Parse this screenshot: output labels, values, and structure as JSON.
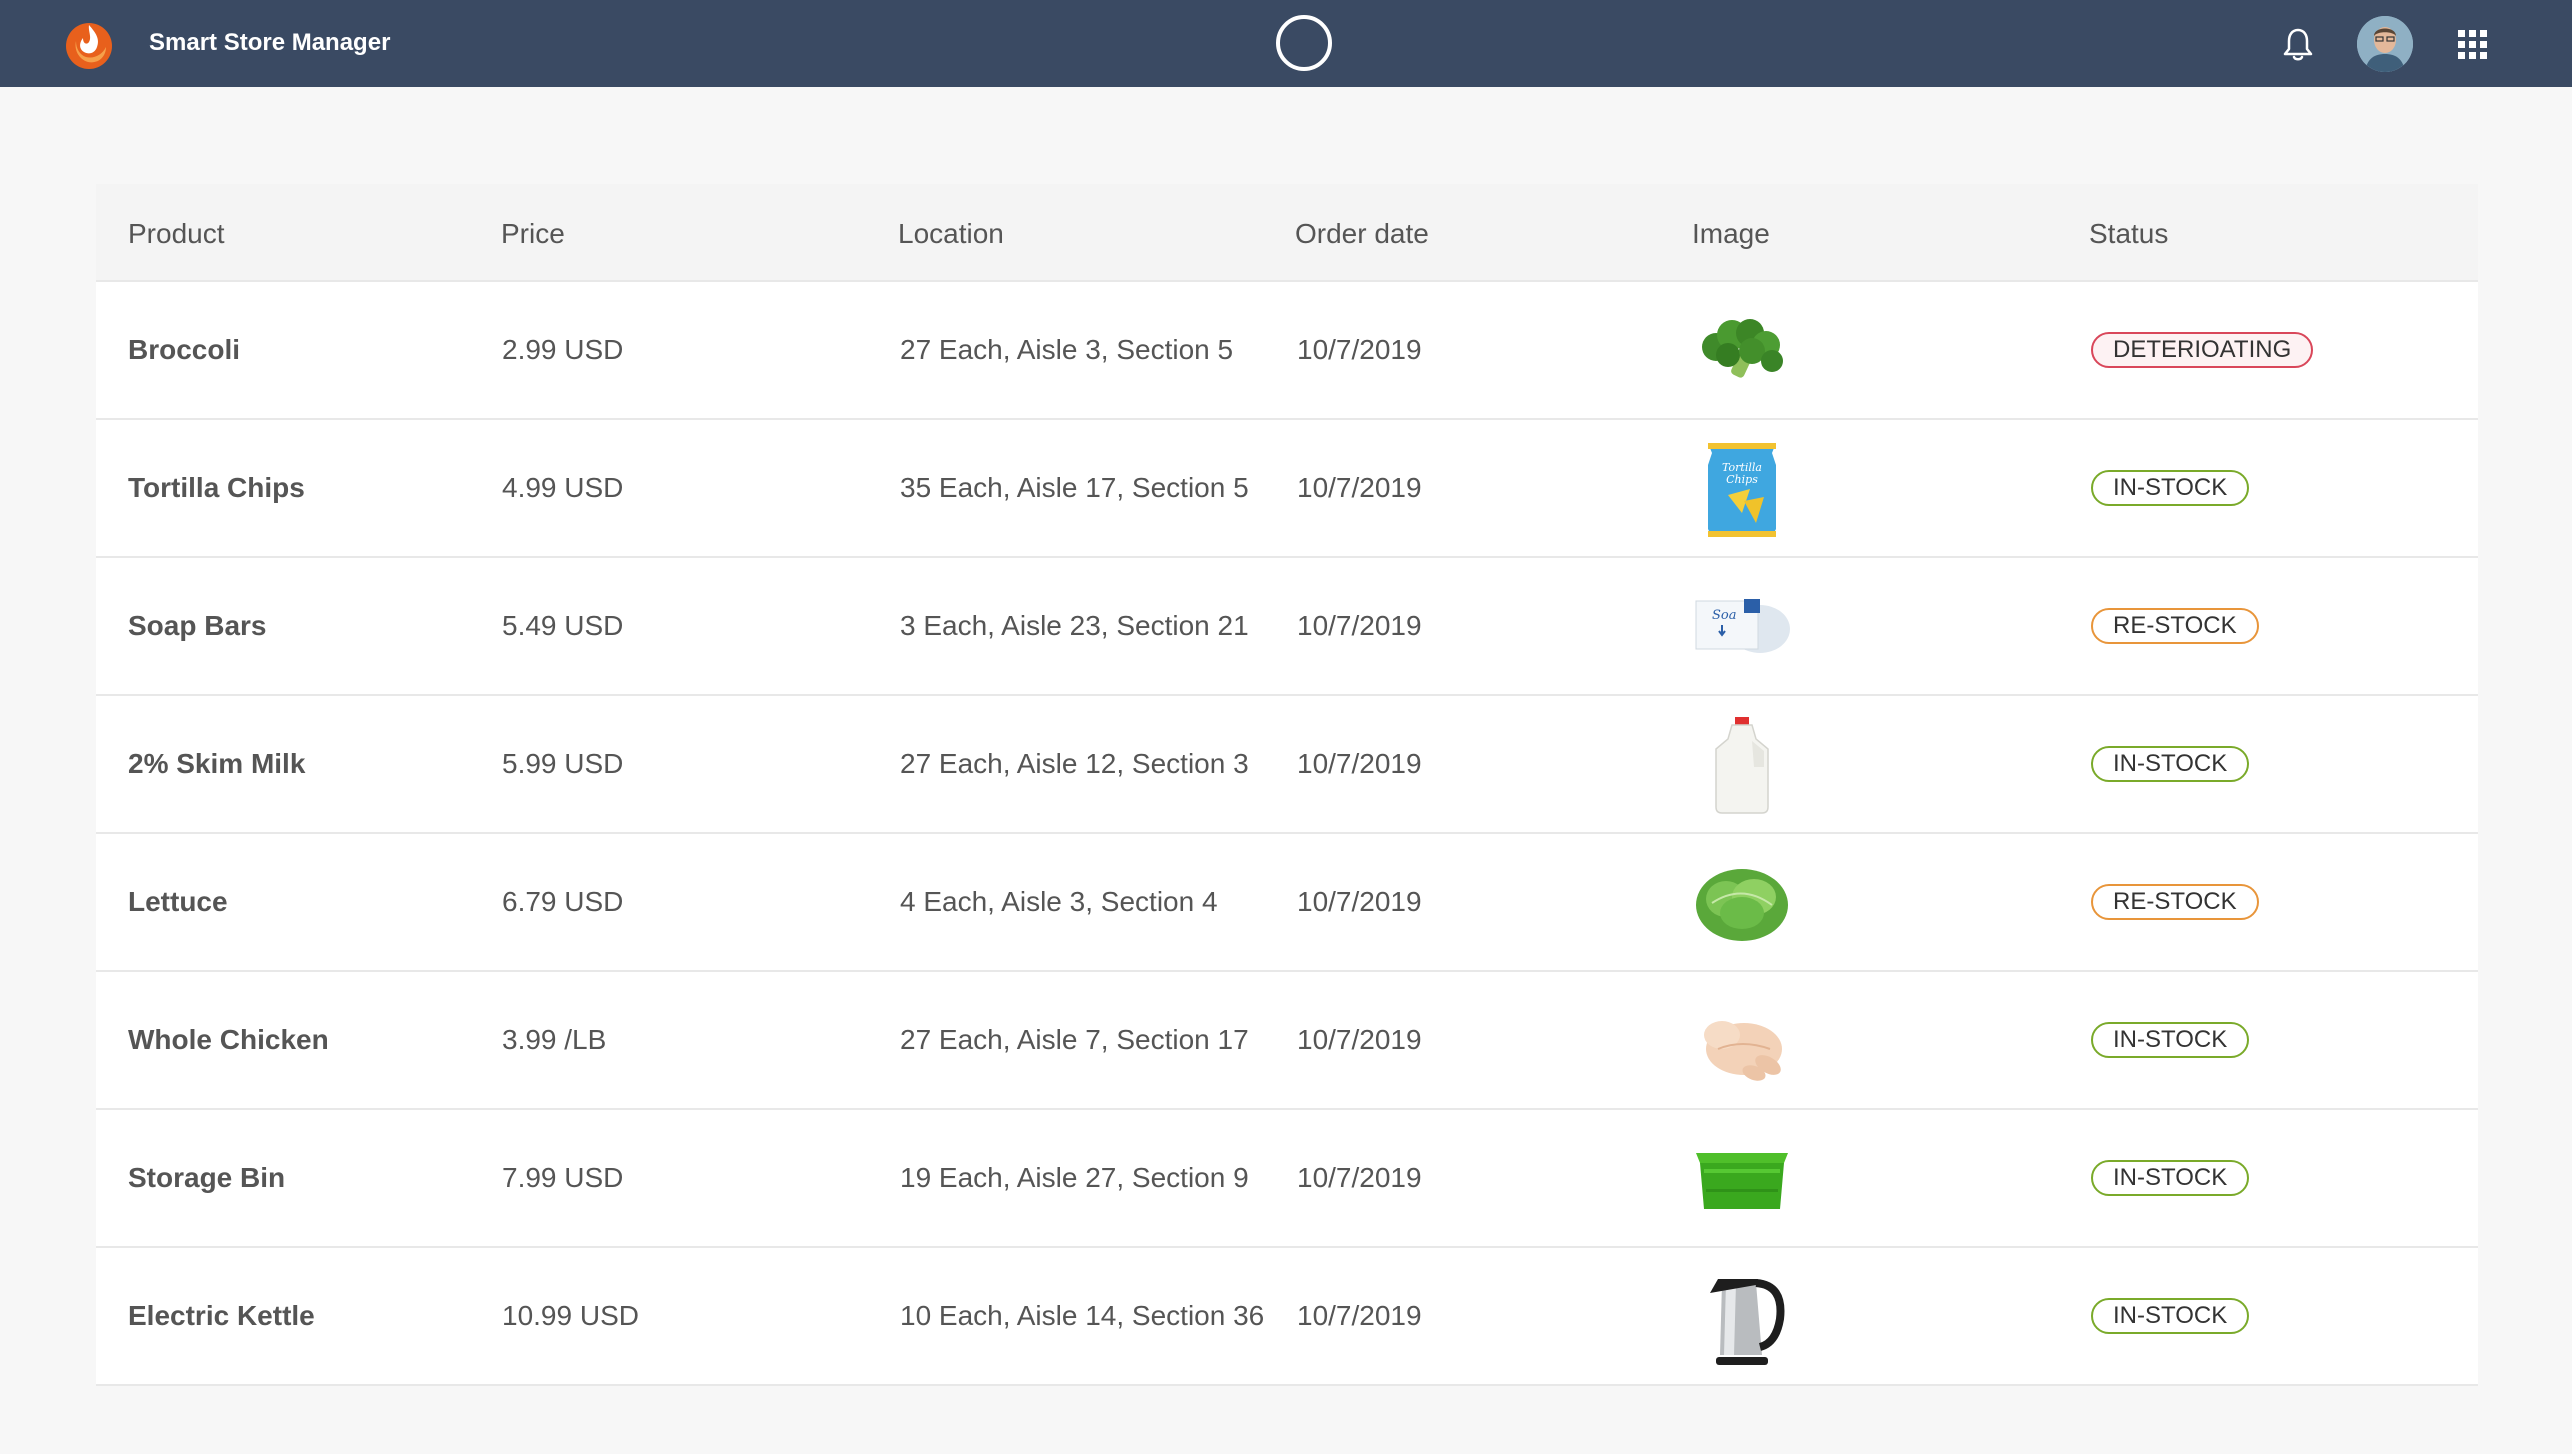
{
  "header": {
    "app_title": "Smart Store Manager",
    "icons": [
      "flame-logo-icon",
      "loading-spinner-icon",
      "bell-icon",
      "avatar",
      "apps-grid-icon"
    ]
  },
  "table": {
    "columns": [
      "Product",
      "Price",
      "Location",
      "Order date",
      "Image",
      "Status"
    ],
    "rows": [
      {
        "product": "Broccoli",
        "price": "2.99 USD",
        "location": "27 Each, Aisle 3, Section 5",
        "date": "10/7/2019",
        "image": "broccoli",
        "status": "DETERIOATING",
        "status_kind": "det"
      },
      {
        "product": "Tortilla Chips",
        "price": "4.99 USD",
        "location": "35 Each, Aisle 17, Section 5",
        "date": "10/7/2019",
        "image": "chips",
        "status": "IN-STOCK",
        "status_kind": "in",
        "image_text": [
          "Tortilla",
          "Chips"
        ]
      },
      {
        "product": "Soap Bars",
        "price": "5.49 USD",
        "location": "3 Each, Aisle 23, Section 21",
        "date": "10/7/2019",
        "image": "soap",
        "status": "RE-STOCK",
        "status_kind": "re",
        "image_text": [
          "Soa"
        ]
      },
      {
        "product": "2% Skim Milk",
        "price": "5.99 USD",
        "location": "27 Each, Aisle 12, Section 3",
        "date": "10/7/2019",
        "image": "milk",
        "status": "IN-STOCK",
        "status_kind": "in"
      },
      {
        "product": "Lettuce",
        "price": "6.79 USD",
        "location": "4 Each, Aisle 3, Section 4",
        "date": "10/7/2019",
        "image": "lettuce",
        "status": "RE-STOCK",
        "status_kind": "re"
      },
      {
        "product": "Whole Chicken",
        "price": "3.99 /LB",
        "location": "27 Each, Aisle 7, Section 17",
        "date": "10/7/2019",
        "image": "chicken",
        "status": "IN-STOCK",
        "status_kind": "in"
      },
      {
        "product": "Storage Bin",
        "price": "7.99 USD",
        "location": "19 Each, Aisle 27, Section 9",
        "date": "10/7/2019",
        "image": "bin",
        "status": "IN-STOCK",
        "status_kind": "in"
      },
      {
        "product": "Electric Kettle",
        "price": "10.99 USD",
        "location": "10 Each, Aisle 14, Section 36",
        "date": "10/7/2019",
        "image": "kettle",
        "status": "IN-STOCK",
        "status_kind": "in"
      }
    ]
  },
  "colors": {
    "topbar": "#3a4a63",
    "in_stock": "#7aaa2a",
    "re_stock": "#e8953a",
    "deteriorating": "#d9475a"
  }
}
